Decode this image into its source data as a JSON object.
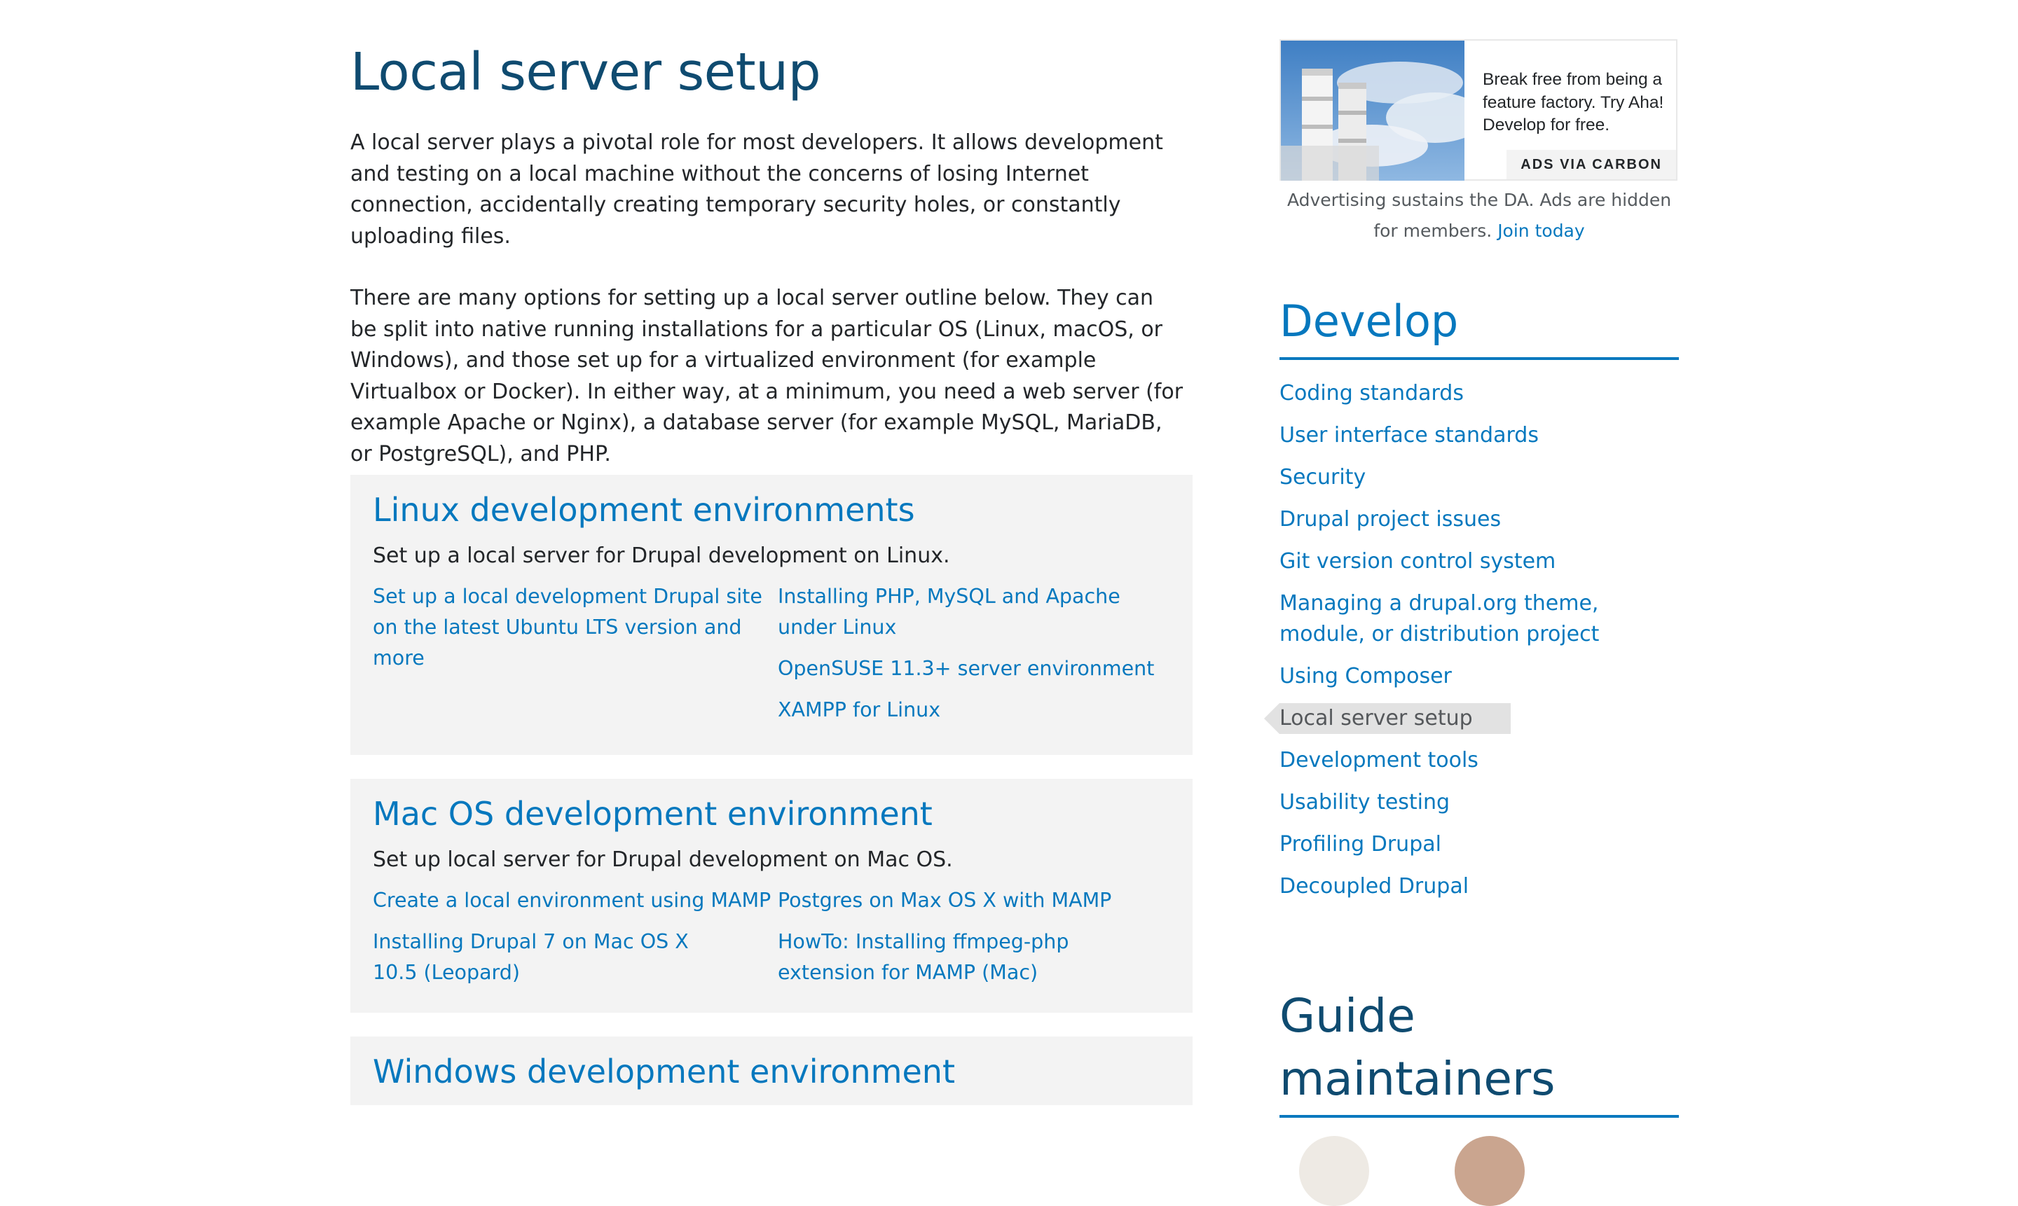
{
  "main": {
    "title": "Local server setup",
    "intro": [
      "A local server plays a pivotal role for most developers. It allows development and testing on a local machine without the concerns of losing Internet connection, accidentally creating temporary security holes, or constantly uploading files.",
      "There are many options for setting up a local server outline below. They can be split into native running installations for a particular OS (Linux, macOS, or Windows), and those set up for a virtualized environment (for example Virtualbox or Docker). In either way, at a minimum, you need a web server (for example Apache or Nginx), a database server (for example MySQL, MariaDB, or PostgreSQL), and PHP."
    ],
    "sections": [
      {
        "title": "Linux development environments",
        "description": "Set up a local server for Drupal development on Linux.",
        "left_links": [
          "Set up a local development Drupal site on the latest Ubuntu LTS version and more"
        ],
        "right_links": [
          "Installing PHP, MySQL and Apache under Linux",
          "OpenSUSE 11.3+ server environment",
          "XAMPP for Linux"
        ]
      },
      {
        "title": "Mac OS development environment",
        "description": "Set up local server for Drupal development on Mac OS.",
        "left_links": [
          "Create a local environment using MAMP",
          "Installing Drupal 7 on Mac OS X 10.5 (Leopard)"
        ],
        "right_links": [
          "Postgres on Max OS X with MAMP",
          "HowTo: Installing ffmpeg-php extension for MAMP (Mac)"
        ]
      },
      {
        "title": "Windows development environment"
      }
    ]
  },
  "sidebar": {
    "ad": {
      "text": "Break free from being a feature factory. Try Aha! Develop for free.",
      "via": "ADS VIA CARBON",
      "note": "Advertising sustains the DA. Ads are hidden for members.",
      "join": "Join today"
    },
    "develop_title": "Develop",
    "nav_items": [
      "Coding standards",
      "User interface standards",
      "Security",
      "Drupal project issues",
      "Git version control system",
      "Managing a drupal.org theme, module, or distribution project",
      "Using Composer",
      "Local server setup",
      "Development tools",
      "Usability testing",
      "Profiling Drupal",
      "Decoupled Drupal"
    ],
    "active_item": "Local server setup",
    "maintainers_title": "Guide maintainers"
  },
  "colors": {
    "link": "#0678be",
    "heading_dark": "#0f4b70",
    "card_bg": "#f3f3f3",
    "active_bg": "#e2e2e2"
  }
}
